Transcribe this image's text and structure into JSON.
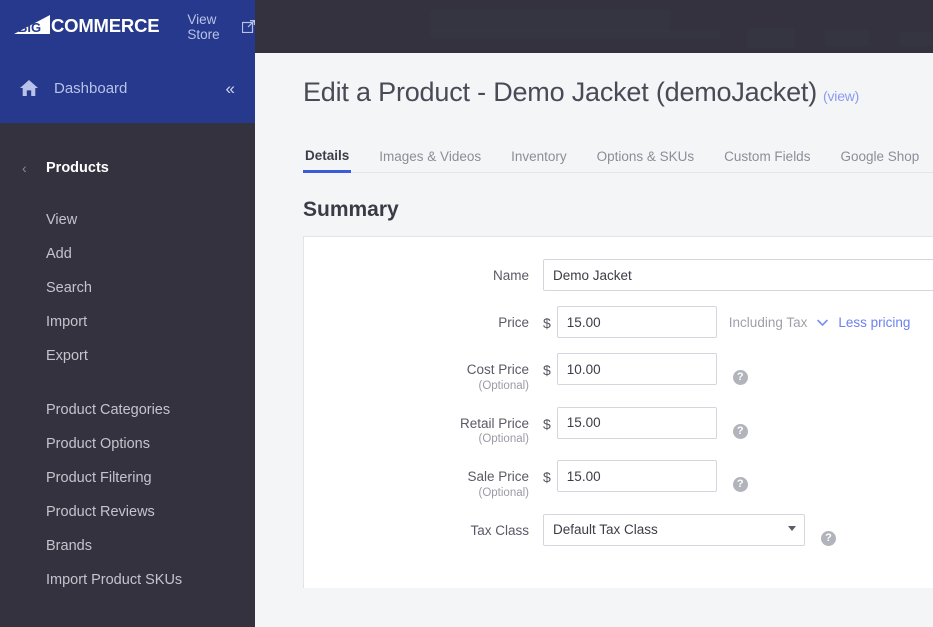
{
  "colors": {
    "brand_blue": "#26398c",
    "sidebar_dark": "#33323e",
    "accent_link": "#6b82ee",
    "tab_active_underline": "#3b5bdb",
    "page_bg": "#f4f5f7"
  },
  "sidebar": {
    "logo": {
      "mark_text": "BIG",
      "word": "COMMERCE"
    },
    "view_store": {
      "label": "View Store",
      "icon": "external-link-icon"
    },
    "dashboard": {
      "label": "Dashboard",
      "icon": "home-icon"
    },
    "collapse": {
      "glyph": "«"
    },
    "section": {
      "back_glyph": "‹",
      "title": "Products"
    },
    "items_primary": [
      {
        "label": "View"
      },
      {
        "label": "Add"
      },
      {
        "label": "Search"
      },
      {
        "label": "Import"
      },
      {
        "label": "Export"
      }
    ],
    "items_secondary": [
      {
        "label": "Product Categories"
      },
      {
        "label": "Product Options"
      },
      {
        "label": "Product Filtering"
      },
      {
        "label": "Product Reviews"
      },
      {
        "label": "Brands"
      },
      {
        "label": "Import Product SKUs"
      }
    ]
  },
  "main": {
    "page_title": "Edit a Product - Demo Jacket (demoJacket)",
    "view_link": "(view)",
    "tabs": [
      {
        "label": "Details",
        "active": true
      },
      {
        "label": "Images & Videos",
        "active": false
      },
      {
        "label": "Inventory",
        "active": false
      },
      {
        "label": "Options & SKUs",
        "active": false
      },
      {
        "label": "Custom Fields",
        "active": false
      },
      {
        "label": "Google Shop",
        "active": false
      }
    ],
    "section_title": "Summary",
    "form": {
      "name": {
        "label": "Name",
        "value": "Demo Jacket",
        "placeholder": ""
      },
      "price": {
        "label": "Price",
        "currency": "$",
        "value": "15.00",
        "placeholder": "",
        "including_tax": "Including Tax",
        "less_pricing": "Less pricing",
        "chevron": "⌄"
      },
      "cost_price": {
        "label": "Cost Price",
        "optional": "(Optional)",
        "currency": "$",
        "value": "10.00",
        "placeholder": "",
        "help": "?"
      },
      "retail_price": {
        "label": "Retail Price",
        "optional": "(Optional)",
        "currency": "$",
        "value": "15.00",
        "placeholder": "",
        "help": "?"
      },
      "sale_price": {
        "label": "Sale Price",
        "optional": "(Optional)",
        "currency": "$",
        "value": "15.00",
        "placeholder": "",
        "help": "?"
      },
      "tax_class": {
        "label": "Tax Class",
        "value": "Default Tax Class",
        "options": [
          "Default Tax Class"
        ],
        "help": "?"
      }
    }
  }
}
